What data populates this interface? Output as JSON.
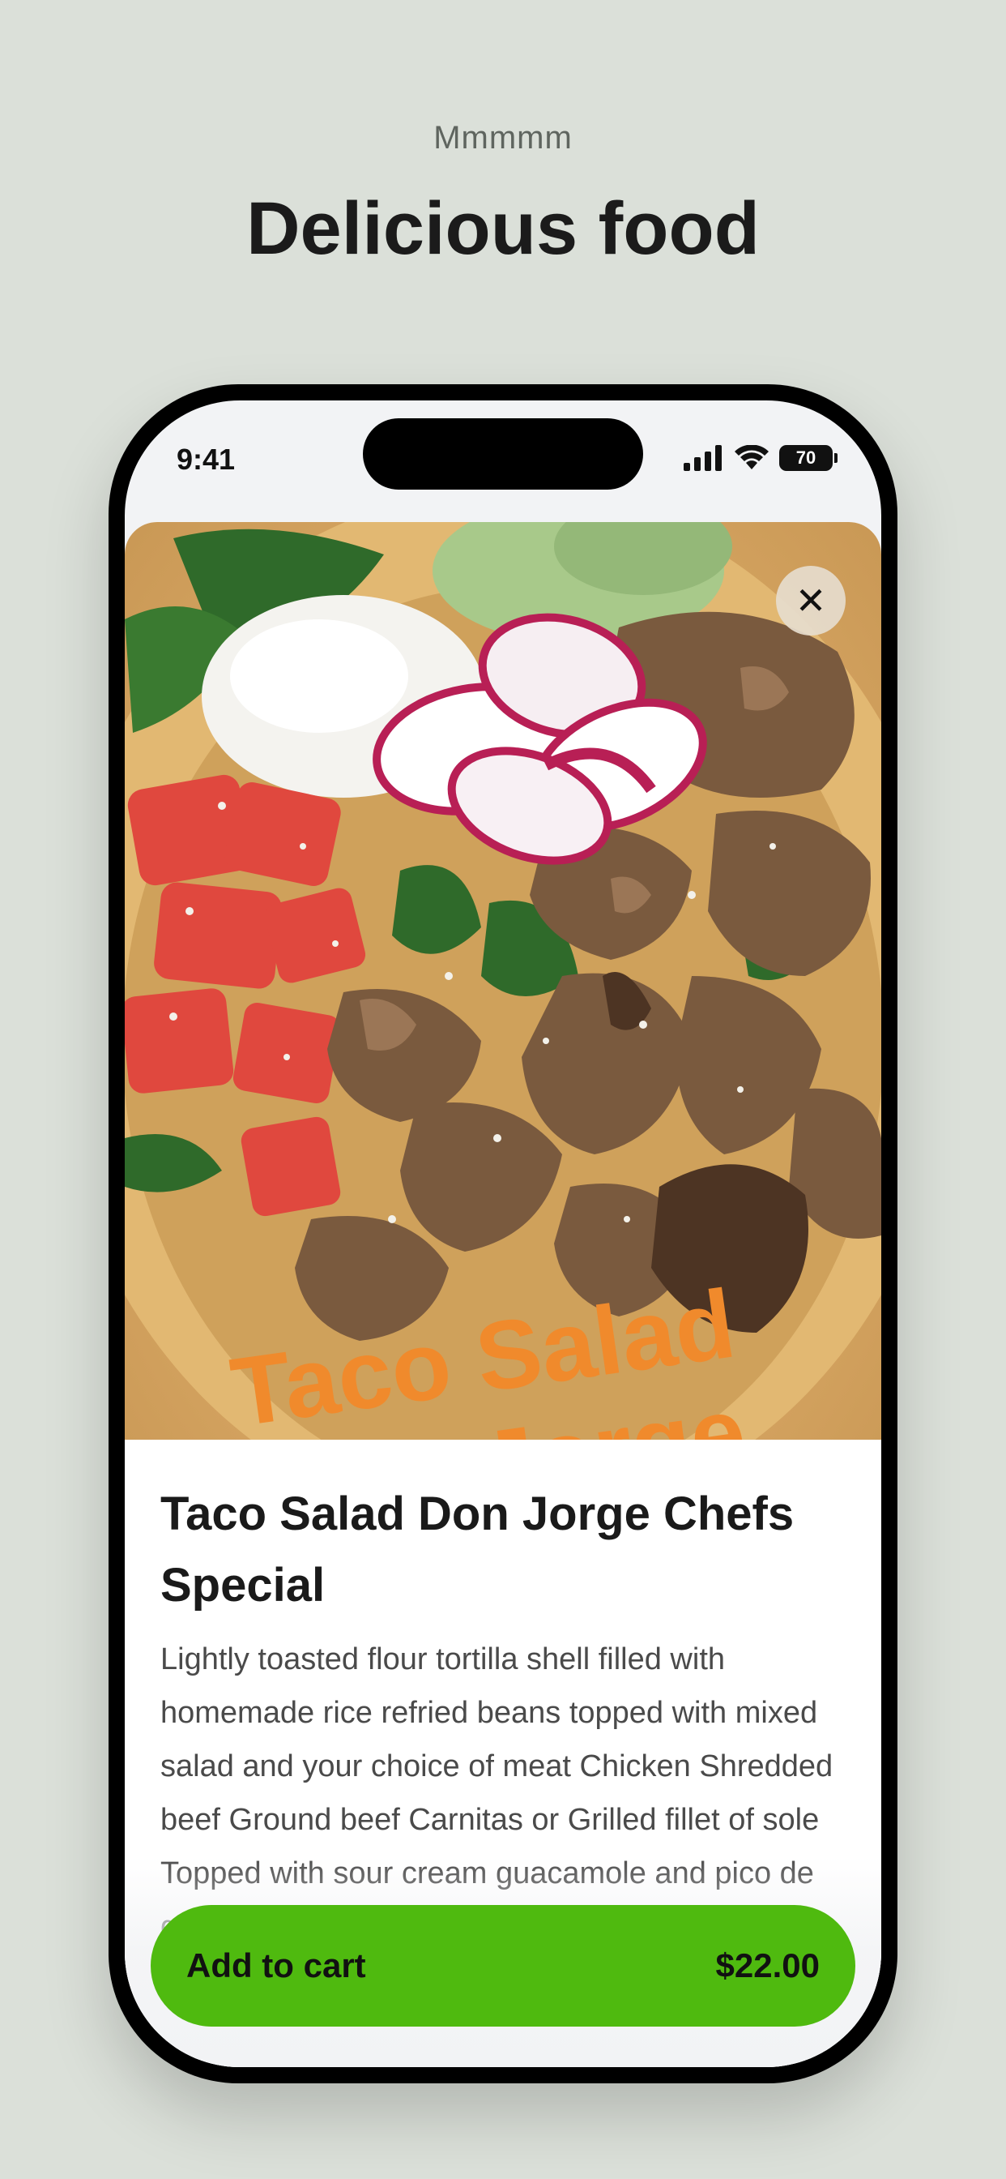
{
  "page": {
    "kicker": "Mmmmm",
    "headline": "Delicious food"
  },
  "status_bar": {
    "time": "9:41",
    "battery": "70",
    "icons": [
      "cellular-signal-icon",
      "wifi-icon",
      "battery-icon"
    ]
  },
  "hero": {
    "photo_caption": "Taco Salad Jorge",
    "close_icon": "close-icon"
  },
  "item": {
    "title": "Taco Salad Don Jorge Chefs Special",
    "description": "Lightly toasted flour tortilla shell filled with homemade rice refried beans topped with mixed salad and your choice of meat Chicken Shredded beef Ground beef Carnitas or Grilled fillet of sole Topped with sour cream guacamole and pico de gallo served on the side"
  },
  "cart": {
    "label": "Add to cart",
    "price": "$22.00"
  },
  "colors": {
    "background": "#dbe0d9",
    "accent": "#4fba0f"
  }
}
